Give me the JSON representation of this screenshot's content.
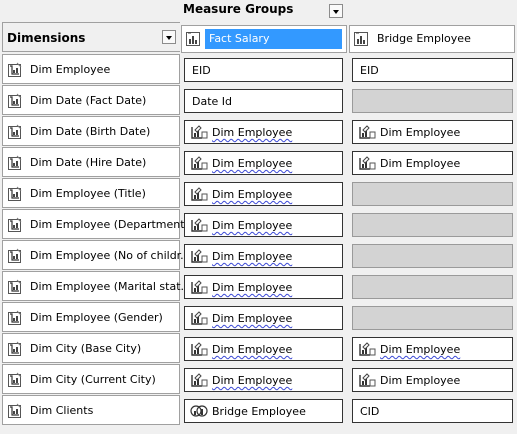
{
  "header": {
    "measure_groups_title": "Measure Groups",
    "dimensions_title": "Dimensions"
  },
  "measure_groups": [
    {
      "name": "Fact Salary",
      "selected": true,
      "icon": "measure-group-icon"
    },
    {
      "name": "Bridge Employee",
      "selected": false,
      "icon": "measure-group-icon"
    }
  ],
  "rows": [
    {
      "dimension": "Dim Employee",
      "cells": [
        {
          "text": "EID",
          "kind": "attribute"
        },
        {
          "text": "EID",
          "kind": "attribute"
        }
      ]
    },
    {
      "dimension": "Dim Date (Fact Date)",
      "cells": [
        {
          "text": "Date Id",
          "kind": "attribute"
        },
        {
          "text": "",
          "kind": "empty"
        }
      ]
    },
    {
      "dimension": "Dim Date (Birth Date)",
      "cells": [
        {
          "text": "Dim Employee",
          "kind": "referenced-dimension",
          "wavy": true
        },
        {
          "text": "Dim Employee",
          "kind": "referenced-dimension",
          "wavy": false
        }
      ]
    },
    {
      "dimension": "Dim Date (Hire Date)",
      "cells": [
        {
          "text": "Dim Employee",
          "kind": "referenced-dimension",
          "wavy": true
        },
        {
          "text": "Dim Employee",
          "kind": "referenced-dimension",
          "wavy": false
        }
      ]
    },
    {
      "dimension": "Dim Employee (Title)",
      "cells": [
        {
          "text": "Dim Employee",
          "kind": "referenced-dimension",
          "wavy": true
        },
        {
          "text": "",
          "kind": "empty"
        }
      ]
    },
    {
      "dimension": "Dim Employee (Department)",
      "cells": [
        {
          "text": "Dim Employee",
          "kind": "referenced-dimension",
          "wavy": true
        },
        {
          "text": "",
          "kind": "empty"
        }
      ]
    },
    {
      "dimension": "Dim Employee (No of childr...",
      "cells": [
        {
          "text": "Dim Employee",
          "kind": "referenced-dimension",
          "wavy": true
        },
        {
          "text": "",
          "kind": "empty"
        }
      ]
    },
    {
      "dimension": "Dim Employee (Marital stat...",
      "cells": [
        {
          "text": "Dim Employee",
          "kind": "referenced-dimension",
          "wavy": true
        },
        {
          "text": "",
          "kind": "empty"
        }
      ]
    },
    {
      "dimension": "Dim Employee (Gender)",
      "cells": [
        {
          "text": "Dim Employee",
          "kind": "referenced-dimension",
          "wavy": true
        },
        {
          "text": "",
          "kind": "empty"
        }
      ]
    },
    {
      "dimension": "Dim City (Base City)",
      "cells": [
        {
          "text": "Dim Employee",
          "kind": "referenced-dimension",
          "wavy": true
        },
        {
          "text": "Dim Employee",
          "kind": "referenced-dimension",
          "wavy": true
        }
      ]
    },
    {
      "dimension": "Dim City (Current City)",
      "cells": [
        {
          "text": "Dim Employee",
          "kind": "referenced-dimension",
          "wavy": true
        },
        {
          "text": "Dim Employee",
          "kind": "referenced-dimension",
          "wavy": false
        }
      ]
    },
    {
      "dimension": "Dim Clients",
      "cells": [
        {
          "text": "Bridge Employee",
          "kind": "many-to-many",
          "wavy": false
        },
        {
          "text": "CID",
          "kind": "attribute"
        }
      ]
    }
  ],
  "colors": {
    "selection": "#3399ff",
    "empty_cell": "#d3d3d3",
    "wavy_underline": "#3b49d6"
  }
}
